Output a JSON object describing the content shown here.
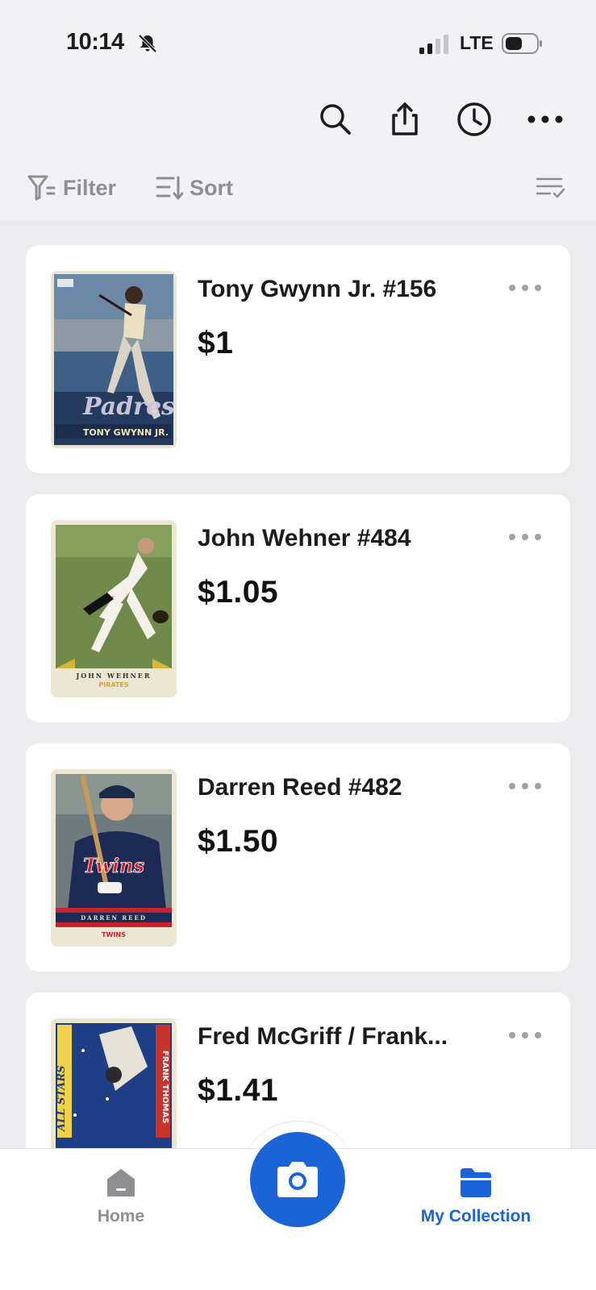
{
  "status_bar": {
    "time": "10:14",
    "network": "LTE"
  },
  "toolbar": {
    "icons": [
      "search-icon",
      "share-icon",
      "history-icon",
      "more-icon"
    ]
  },
  "filter_bar": {
    "filter_label": "Filter",
    "sort_label": "Sort"
  },
  "cards": [
    {
      "name": "Tony Gwynn Jr. #156",
      "price": "$1",
      "card_text": "TONY GWYNN JR.",
      "card_team": "Padres"
    },
    {
      "name": "John Wehner #484",
      "price": "$1.05",
      "card_text": "JOHN WEHNER",
      "card_team": "PIRATES"
    },
    {
      "name": "Darren Reed #482",
      "price": "$1.50",
      "card_text": "DARREN REED",
      "card_team": "TWINS"
    },
    {
      "name": "Fred McGriff / Frank...",
      "price": "$1.41",
      "card_text": "FRANK THOMAS",
      "card_team": "ALL STARS"
    }
  ],
  "tabbar": {
    "home_label": "Home",
    "collection_label": "My Collection",
    "accent_color": "#1a64d8",
    "inactive_color": "#8e8e93"
  }
}
